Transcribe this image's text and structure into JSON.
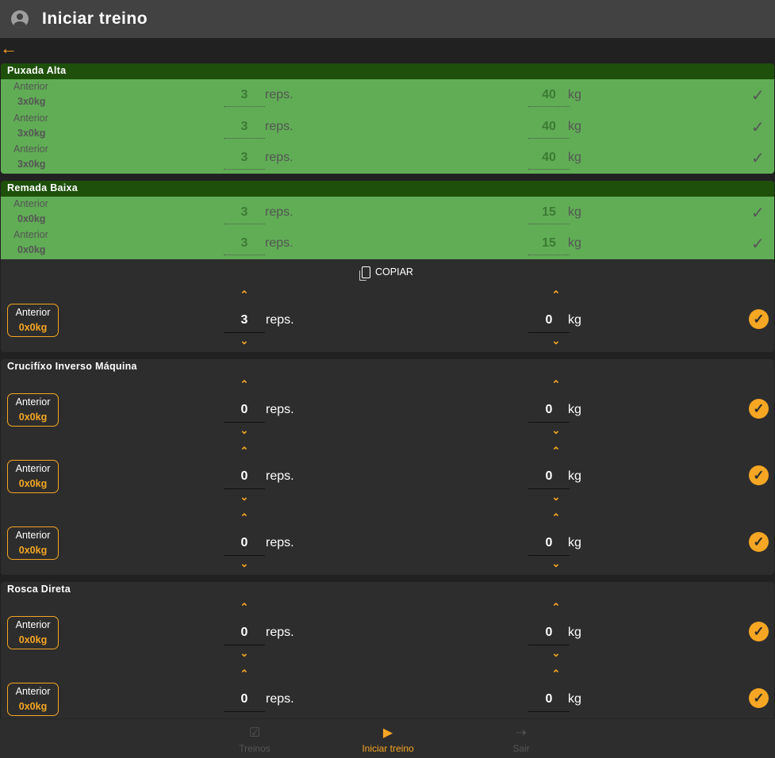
{
  "header": {
    "title": "Iniciar treino"
  },
  "copy_label": "COPIAR",
  "exercises": [
    {
      "name": "Puxada Alta",
      "sets": [
        {
          "done": true,
          "prev_label": "Anterior",
          "prev": "3x0kg",
          "reps": "3",
          "reps_unit": "reps.",
          "weight": "40",
          "weight_unit": "kg"
        },
        {
          "done": true,
          "prev_label": "Anterior",
          "prev": "3x0kg",
          "reps": "3",
          "reps_unit": "reps.",
          "weight": "40",
          "weight_unit": "kg"
        },
        {
          "done": true,
          "prev_label": "Anterior",
          "prev": "3x0kg",
          "reps": "3",
          "reps_unit": "reps.",
          "weight": "40",
          "weight_unit": "kg"
        }
      ]
    },
    {
      "name": "Remada Baixa",
      "copy": true,
      "sets": [
        {
          "done": true,
          "prev_label": "Anterior",
          "prev": "0x0kg",
          "reps": "3",
          "reps_unit": "reps.",
          "weight": "15",
          "weight_unit": "kg"
        },
        {
          "done": true,
          "prev_label": "Anterior",
          "prev": "0x0kg",
          "reps": "3",
          "reps_unit": "reps.",
          "weight": "15",
          "weight_unit": "kg"
        },
        {
          "done": false,
          "prev_label": "Anterior",
          "prev": "0x0kg",
          "reps": "3",
          "reps_unit": "reps.",
          "weight": "0",
          "weight_unit": "kg"
        }
      ]
    },
    {
      "name": "Crucifíxo Inverso Máquina",
      "sets": [
        {
          "done": false,
          "prev_label": "Anterior",
          "prev": "0x0kg",
          "reps": "0",
          "reps_unit": "reps.",
          "weight": "0",
          "weight_unit": "kg"
        },
        {
          "done": false,
          "prev_label": "Anterior",
          "prev": "0x0kg",
          "reps": "0",
          "reps_unit": "reps.",
          "weight": "0",
          "weight_unit": "kg"
        },
        {
          "done": false,
          "prev_label": "Anterior",
          "prev": "0x0kg",
          "reps": "0",
          "reps_unit": "reps.",
          "weight": "0",
          "weight_unit": "kg"
        }
      ]
    },
    {
      "name": "Rosca Direta",
      "sets": [
        {
          "done": false,
          "prev_label": "Anterior",
          "prev": "0x0kg",
          "reps": "0",
          "reps_unit": "reps.",
          "weight": "0",
          "weight_unit": "kg"
        },
        {
          "done": false,
          "prev_label": "Anterior",
          "prev": "0x0kg",
          "reps": "0",
          "reps_unit": "reps.",
          "weight": "0",
          "weight_unit": "kg"
        }
      ]
    }
  ],
  "nav": [
    {
      "label": "Treinos",
      "color": "#555555"
    },
    {
      "label": "Iniciar treino",
      "color": "#f5a623"
    },
    {
      "label": "Sair",
      "color": "#555555"
    }
  ]
}
